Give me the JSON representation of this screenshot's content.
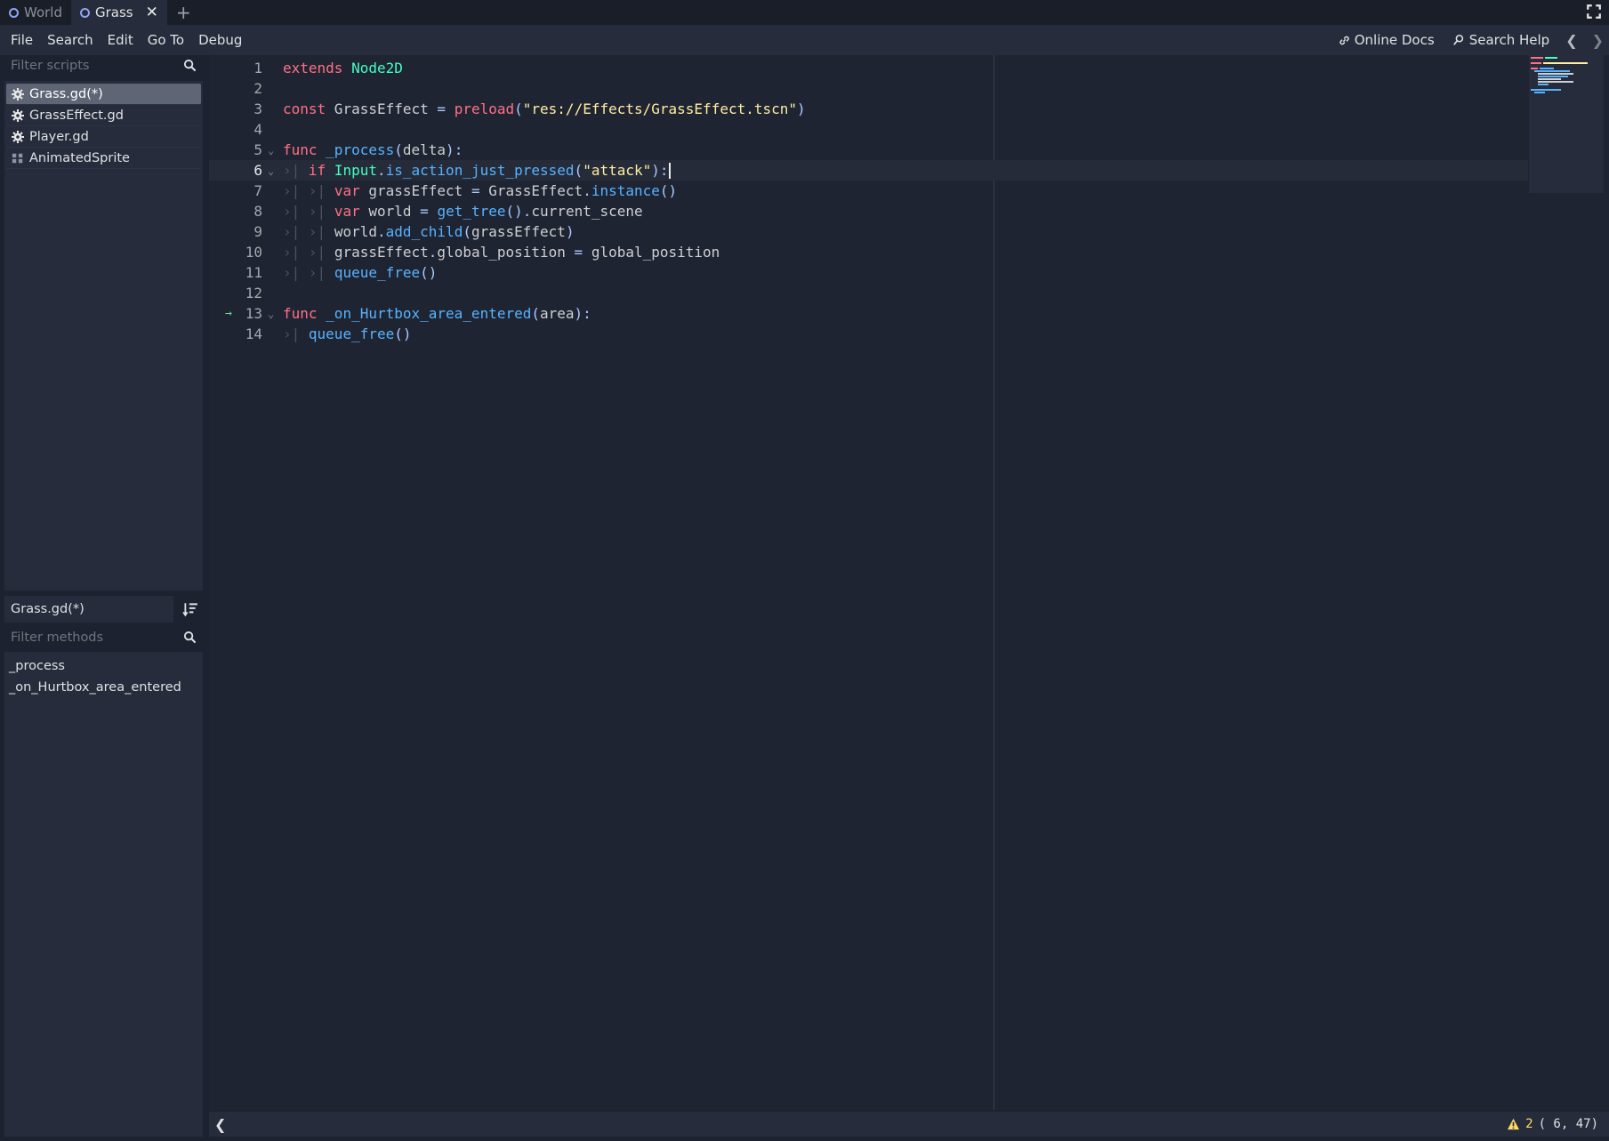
{
  "tabs": [
    {
      "label": "World",
      "active": false
    },
    {
      "label": "Grass",
      "active": true
    }
  ],
  "menu": [
    "File",
    "Search",
    "Edit",
    "Go To",
    "Debug"
  ],
  "menu_right": {
    "online_docs": "Online Docs",
    "search_help": "Search Help"
  },
  "left_panel": {
    "filter_scripts_placeholder": "Filter scripts",
    "scripts": [
      {
        "label": "Grass.gd(*)",
        "icon": "gear-icon",
        "selected": true
      },
      {
        "label": "GrassEffect.gd",
        "icon": "gear-icon",
        "selected": false
      },
      {
        "label": "Player.gd",
        "icon": "gear-icon",
        "selected": false
      },
      {
        "label": "AnimatedSprite",
        "icon": "doc-icon",
        "selected": false
      }
    ],
    "current_script": "Grass.gd(*)",
    "filter_methods_placeholder": "Filter methods",
    "methods": [
      "_process",
      "_on_Hurtbox_area_entered"
    ]
  },
  "editor": {
    "current_line": 6,
    "lines": [
      "extends Node2D",
      "",
      "const GrassEffect = preload(\"res://Effects/GrassEffect.tscn\")",
      "",
      "func _process(delta):",
      "\tif Input.is_action_just_pressed(\"attack\"):",
      "\t\tvar grassEffect = GrassEffect.instance()",
      "\t\tvar world = get_tree().current_scene",
      "\t\tworld.add_child(grassEffect)",
      "\t\tgrassEffect.global_position = global_position",
      "\t\tqueue_free()",
      "",
      "func _on_Hurtbox_area_entered(area):",
      "\tqueue_free()"
    ]
  },
  "status": {
    "warnings": "2",
    "position": "(   6, 47)"
  }
}
